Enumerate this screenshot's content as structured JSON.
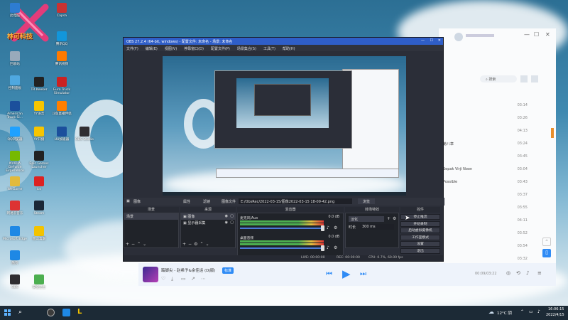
{
  "desktop": {
    "logo_text": "林可科技",
    "icons": [
      {
        "label": "此电脑",
        "name": "this-pc-icon",
        "color": "#2d7cd1"
      },
      {
        "label": "Capsa",
        "name": "capsa-icon",
        "color": "#c83232"
      },
      {
        "label": "回收站",
        "name": "recycle-bin-icon",
        "color": "#9ab"
      },
      {
        "label": "腾讯QQ",
        "name": "qq-icon",
        "color": "#1296db"
      },
      {
        "label": "控制面板",
        "name": "control-panel-icon",
        "color": "#4fa8e0"
      },
      {
        "label": "腾讯视频",
        "name": "tencent-video-icon",
        "color": "#ff7a00"
      },
      {
        "label": "TR Keeker",
        "name": "tr-icon",
        "color": "#222"
      },
      {
        "label": "Euro Truck Simulator",
        "name": "truck-icon",
        "color": "#c22"
      },
      {
        "label": "American Truck Si...",
        "name": "american-truck-icon",
        "color": "#1b4f9c"
      },
      {
        "label": "YY语音",
        "name": "yy-icon",
        "color": "#f7c500"
      },
      {
        "label": "斗鱼直播伴侣",
        "name": "douyu-icon",
        "color": "#ff7f00"
      },
      {
        "label": "QQ浏览器",
        "name": "qq-browser-icon",
        "color": "#1fa1ff"
      },
      {
        "label": "YY开播",
        "name": "yy-live-icon",
        "color": "#f7c500"
      },
      {
        "label": "UU加速器",
        "name": "uu-icon",
        "color": "#1b4f9c"
      },
      {
        "label": "OBS Studio",
        "name": "obs-icon",
        "color": "#302e31"
      },
      {
        "label": "NVIDIA GeForce Experience",
        "name": "nvidia-icon",
        "color": "#76b900"
      },
      {
        "label": "Epic Games Launcher",
        "name": "epic-icon",
        "color": "#222"
      },
      {
        "label": "WeGame",
        "name": "wegame-icon",
        "color": "#e2ba3c"
      },
      {
        "label": "ios",
        "name": "ios-icon",
        "color": "#d22"
      },
      {
        "label": "网易云音乐",
        "name": "netease-music-icon",
        "color": "#d33"
      },
      {
        "label": "Steam",
        "name": "steam-icon",
        "color": "#1b2838"
      },
      {
        "label": "Microsoft Edge",
        "name": "edge-icon",
        "color": "#1e88e5"
      },
      {
        "label": "金山毒霸",
        "name": "star-icon",
        "color": "#f3c300"
      },
      {
        "label": "酷狗",
        "name": "kugou-icon",
        "color": "#1e88e5"
      },
      {
        "label": "OBS",
        "name": "obs-small-icon",
        "color": "#302e31"
      },
      {
        "label": "安全卫士",
        "name": "security-icon",
        "color": "#4caf50"
      }
    ]
  },
  "obs": {
    "title": "OBS 27.2.4 (64-bit, windows) - 配置文件: 未命名 - 场景: 未命名",
    "menu": [
      "文件(F)",
      "编辑(E)",
      "视图(V)",
      "停靠窗口(D)",
      "配置文件(P)",
      "场景集合(S)",
      "工具(T)",
      "帮助(H)"
    ],
    "source_bar": {
      "label": "图像",
      "props": "属性",
      "filters": "滤镜",
      "file_label": "图像文件",
      "file_value": "E:/ObsRec/2022-03-15/图像2022-03-15 18-09-42.png",
      "browse": "浏览"
    },
    "docks": {
      "scenes": "场景",
      "sources": "来源",
      "mixer": "混音器",
      "transitions": "转场特效",
      "controls": "控件"
    },
    "scenes": [
      "场景"
    ],
    "sources": [
      "图像",
      "显示器采集"
    ],
    "mixer": [
      {
        "name": "麦克风/Aux",
        "db": "0.0 dB"
      },
      {
        "name": "桌面音频",
        "db": "0.0 dB"
      }
    ],
    "transition": {
      "type": "淡化",
      "duration_label": "时长",
      "duration": "300 ms"
    },
    "controls": [
      "停止推流",
      "开始录制",
      "启动虚拟摄像机",
      "工作室模式",
      "设置",
      "退出"
    ],
    "status": {
      "live": "LIVE: 00:00:00",
      "rec": "REC: 00:00:00",
      "cpu": "CPU: 0.7%, 60.00 fps"
    }
  },
  "music": {
    "search": "搜索",
    "rows": [
      {
        "title": "",
        "dur": "03:14"
      },
      {
        "title": "",
        "dur": "03:26"
      },
      {
        "title": "",
        "dur": "04:13"
      },
      {
        "title": "第八章",
        "dur": "03:24"
      },
      {
        "title": "",
        "dur": "03:45"
      },
      {
        "title": "Sepak Virji Noon",
        "dur": "03:04"
      },
      {
        "title": "Possible",
        "dur": "03:43"
      },
      {
        "title": "",
        "dur": "03:37"
      },
      {
        "title": "",
        "dur": "03:55"
      },
      {
        "title": "",
        "dur": "04:11"
      },
      {
        "title": "",
        "dur": "03:52"
      },
      {
        "title": "",
        "dur": "03:54"
      },
      {
        "title": "",
        "dur": "03:32"
      }
    ]
  },
  "player": {
    "title": "踮脚尖 - 赵希予&余佳运 (Dj版)",
    "tag": "标准",
    "time": "00:09/03:22"
  },
  "taskbar": {
    "weather": "12°C 阴",
    "time": "16:06:15",
    "date": "2022/4/15"
  }
}
